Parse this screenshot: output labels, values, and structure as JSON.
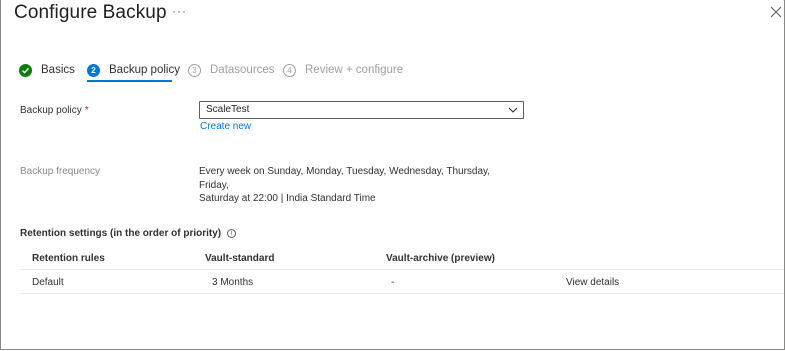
{
  "window": {
    "title": "Configure Backup",
    "more": "···"
  },
  "steps": [
    {
      "label": "Basics",
      "number": "",
      "state": "done"
    },
    {
      "label": "Backup policy",
      "number": "2",
      "state": "active"
    },
    {
      "label": "Datasources",
      "number": "3",
      "state": "pending"
    },
    {
      "label": "Review + configure",
      "number": "4",
      "state": "pending"
    }
  ],
  "form": {
    "policy_label": "Backup policy",
    "required_mark": "*",
    "policy_value": "ScaleTest",
    "create_new": "Create new",
    "frequency_label": "Backup frequency",
    "frequency_line1": "Every week on Sunday, Monday, Tuesday, Wednesday, Thursday, Friday,",
    "frequency_line2": "Saturday at 22:00 | India Standard Time"
  },
  "retention": {
    "title": "Retention settings (in the order of priority)",
    "info_glyph": "i",
    "columns": [
      "Retention rules",
      "Vault-standard",
      "Vault-archive (preview)"
    ],
    "rows": [
      {
        "rule": "Default",
        "standard": "3 Months",
        "archive": "-",
        "action": "View details"
      }
    ]
  },
  "colors": {
    "accent": "#0078d4",
    "success": "#107c10",
    "required": "#a4262c"
  }
}
